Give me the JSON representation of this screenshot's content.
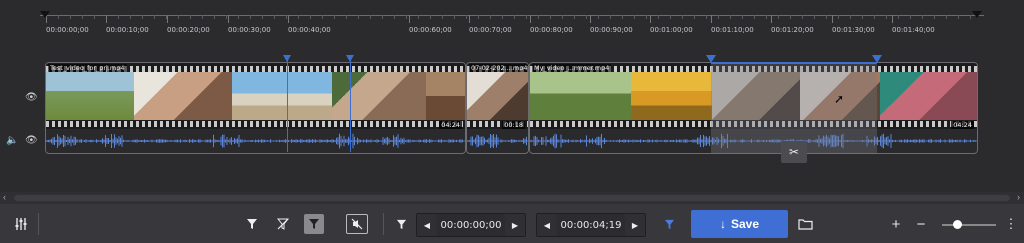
{
  "ruler": {
    "labels": [
      "00:00:00;00",
      "00:00:10;00",
      "00:00:20;00",
      "00:00:30;00",
      "00:00:40;00",
      "00:00:60;00",
      "00:00:70;00",
      "00:00:80;00",
      "00:00:90;00",
      "00:01:00;00",
      "00:01:10;00",
      "00:01:20;00",
      "00:01:30;00",
      "00:01:40;00"
    ]
  },
  "clips": [
    {
      "name": "Test_video_for_prj.mp4",
      "duration": "04:24"
    },
    {
      "name": "07-02-202....mp4",
      "duration": "00:18"
    },
    {
      "name": "My_video_...mmer.mp4",
      "duration": "04:24"
    }
  ],
  "tracks": {
    "visibility_icon": "eye-icon",
    "audio_icon": "speaker-icon"
  },
  "timeline": {
    "scissors_icon": "scissors-icon"
  },
  "toolbar": {
    "mixer_icon": "sliders-icon",
    "filter_icons": [
      "filter-icon",
      "filter-off-icon",
      "filter-selected-icon",
      "mute-icon"
    ],
    "start_timecode": "00:00:00;00",
    "end_timecode": "00:00:04;19",
    "save_label": "Save",
    "plus_label": "+",
    "minus_label": "−",
    "more_label": "⋮",
    "zoom_level": 0.25
  },
  "colors": {
    "accent": "#3f6fd4",
    "waveform": "#5b86d8",
    "background": "#2b2b2e"
  }
}
